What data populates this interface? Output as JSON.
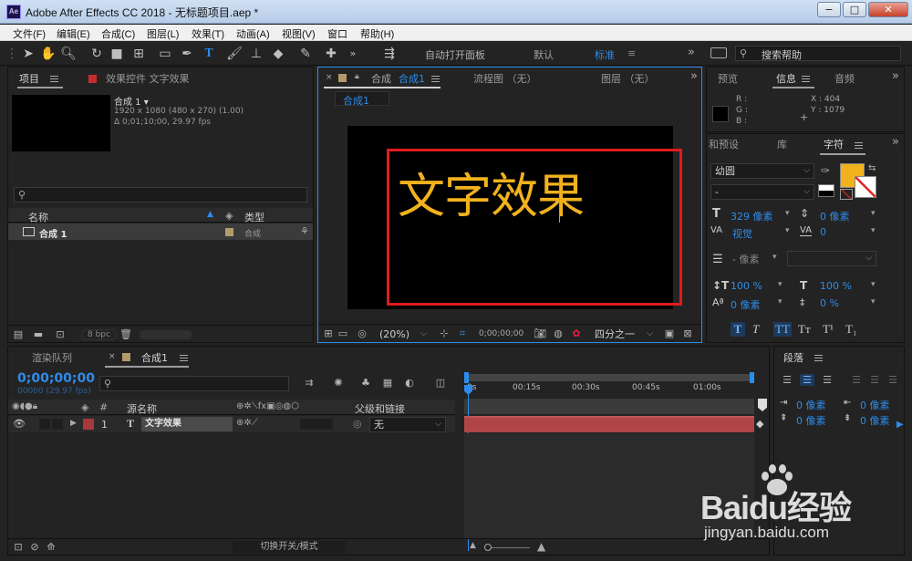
{
  "window": {
    "app_icon": "Ae",
    "title": "Adobe After Effects CC 2018 - 无标题项目.aep *",
    "min": "−",
    "max": "□",
    "close": "✕"
  },
  "menu": [
    "文件(F)",
    "编辑(E)",
    "合成(C)",
    "图层(L)",
    "效果(T)",
    "动画(A)",
    "视图(V)",
    "窗口",
    "帮助(H)"
  ],
  "toolbar": {
    "auto_open_panels": "自动打开面板",
    "workspaces": [
      "默认",
      "标准"
    ],
    "more": "»",
    "search_help_placeholder": "搜索帮助"
  },
  "project_panel": {
    "tab_project": "项目",
    "tab_effects": "效果控件 文字效果",
    "comp_name": "合成 1 ▾",
    "comp_size": "1920 x 1080  (480 x 270) (1.00)",
    "comp_duration": "Δ 0;01;10;00, 29.97 fps",
    "col_name": "名称",
    "col_type": "类型",
    "item_name": "合成 1",
    "item_type": "合成",
    "bpc": "8 bpc"
  },
  "comp_panel": {
    "tab_comp": "合成",
    "tab_comp_name": "合成1",
    "tab_flowchart": "流程图 （无）",
    "tab_layer": "图层 （无）",
    "breadcrumb": "合成1",
    "text": "文字效果",
    "zoom": "(20%)",
    "timecode": "0;00;00;00",
    "resolution": "四分之一",
    "colors": {
      "text": "#f2b21d",
      "box": "#e01b1b"
    }
  },
  "info_panel": {
    "tab_preview": "预览",
    "tab_info": "信息",
    "tab_audio": "音频",
    "r": "R :",
    "g": "G :",
    "b": "B :",
    "x": "X : 404",
    "y": "Y : 1079"
  },
  "character_panel": {
    "tab_presets": "和预设",
    "tab_library": "库",
    "tab_character": "字符",
    "font": "幼圆",
    "style": "-",
    "size": "329 像素",
    "leading": "0 像素",
    "kerning": "视觉",
    "tracking": "0",
    "stroke": "- 像素",
    "vscale": "100 %",
    "hscale": "100 %",
    "baseline": "0 像素",
    "tsume": "0 %",
    "fill_color": "#f2b21d",
    "styles": [
      "T",
      "T",
      "TT",
      "Tт",
      "T¹",
      "T₁"
    ]
  },
  "timeline": {
    "tab_render": "渲染队列",
    "tab_comp": "合成1",
    "timecode": "0;00;00;00",
    "fps": "00000 (29.97 fps)",
    "col_source": "源名称",
    "col_parent": "父级和链接",
    "hash": "#",
    "layer_num": "1",
    "layer_type": "T",
    "layer_name": "文字效果",
    "parent": "无",
    "ticks": [
      "0s",
      "00:15s",
      "00:30s",
      "00:45s",
      "01:00s"
    ],
    "toggle_label": "切换开关/模式",
    "layer_color": "#a8393b"
  },
  "paragraph_panel": {
    "tab": "段落",
    "indent1": "0 像素",
    "indent2": "0 像素",
    "indent3": "0 像素",
    "indent4": "0 像素"
  },
  "watermark": {
    "brand": "Baidu经验",
    "url": "jingyan.baidu.com"
  }
}
